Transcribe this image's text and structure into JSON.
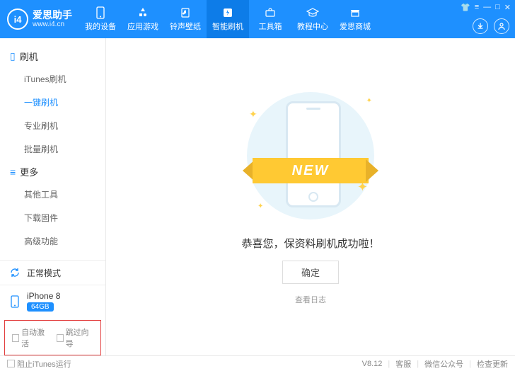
{
  "brand": {
    "logo_text": "i4",
    "title": "爱思助手",
    "subtitle": "www.i4.cn"
  },
  "nav": [
    {
      "label": "我的设备"
    },
    {
      "label": "应用游戏"
    },
    {
      "label": "铃声壁纸"
    },
    {
      "label": "智能刷机"
    },
    {
      "label": "工具箱"
    },
    {
      "label": "教程中心"
    },
    {
      "label": "爱思商城"
    }
  ],
  "sidebar": {
    "group1": {
      "title": "刷机",
      "items": [
        "iTunes刷机",
        "一键刷机",
        "专业刷机",
        "批量刷机"
      ]
    },
    "group2": {
      "title": "更多",
      "items": [
        "其他工具",
        "下载固件",
        "高级功能"
      ]
    },
    "mode": "正常模式",
    "device": {
      "name": "iPhone 8",
      "storage": "64GB"
    },
    "checks": {
      "auto_activate": "自动激活",
      "skip_guide": "跳过向导"
    }
  },
  "main": {
    "ribbon": "NEW",
    "message": "恭喜您，保资料刷机成功啦！",
    "ok": "确定",
    "log": "查看日志"
  },
  "footer": {
    "block_itunes": "阻止iTunes运行",
    "version": "V8.12",
    "support": "客服",
    "wechat": "微信公众号",
    "update": "检查更新"
  }
}
